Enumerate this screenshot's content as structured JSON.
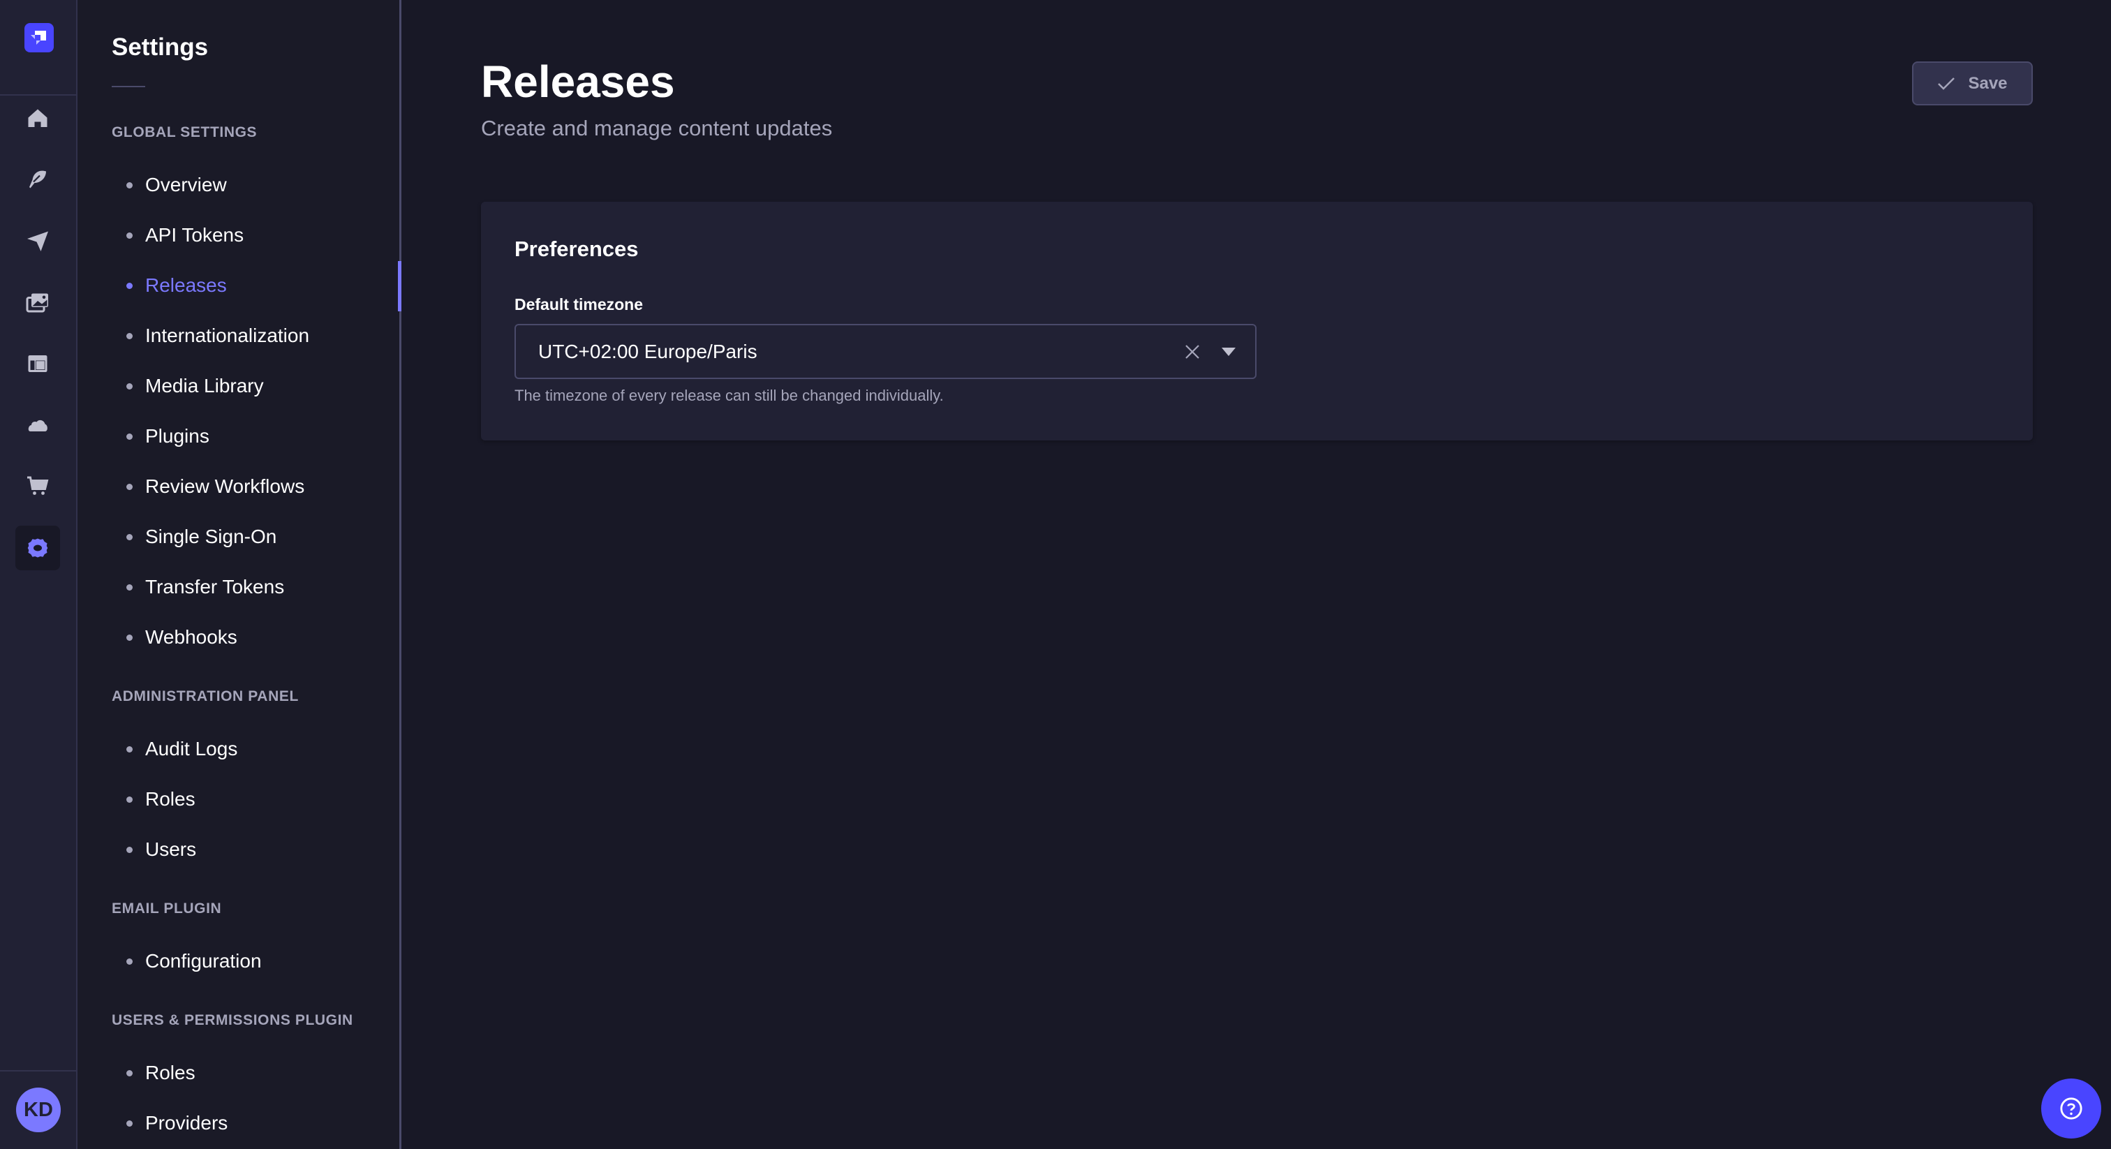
{
  "nav_rail": {
    "items": [
      {
        "icon": "home-icon",
        "label": "Home"
      },
      {
        "icon": "feather-icon",
        "label": "Content Manager"
      },
      {
        "icon": "paper-plane-icon",
        "label": "Releases"
      },
      {
        "icon": "images-icon",
        "label": "Media Library"
      },
      {
        "icon": "layout-icon",
        "label": "Content-Type Builder"
      },
      {
        "icon": "cloud-icon",
        "label": "Deploy"
      },
      {
        "icon": "shopping-cart-icon",
        "label": "Marketplace"
      },
      {
        "icon": "gear-icon",
        "label": "Settings",
        "active": true
      }
    ],
    "avatar_initials": "KD"
  },
  "sidebar": {
    "title": "Settings",
    "sections": [
      {
        "title": "GLOBAL SETTINGS",
        "items": [
          "Overview",
          "API Tokens",
          "Releases",
          "Internationalization",
          "Media Library",
          "Plugins",
          "Review Workflows",
          "Single Sign-On",
          "Transfer Tokens",
          "Webhooks"
        ]
      },
      {
        "title": "ADMINISTRATION PANEL",
        "items": [
          "Audit Logs",
          "Roles",
          "Users"
        ]
      },
      {
        "title": "EMAIL PLUGIN",
        "items": [
          "Configuration"
        ]
      },
      {
        "title": "USERS & PERMISSIONS PLUGIN",
        "items": [
          "Roles",
          "Providers"
        ]
      }
    ],
    "active_item": "Releases"
  },
  "header": {
    "title": "Releases",
    "subtitle": "Create and manage content updates",
    "save_label": "Save"
  },
  "preferences": {
    "title": "Preferences",
    "timezone_label": "Default timezone",
    "timezone_value": "UTC+02:00 Europe/Paris",
    "timezone_hint": "The timezone of every release can still be changed individually."
  },
  "colors": {
    "accent": "#4945ff",
    "accent_light": "#7b79ff",
    "background": "#181826",
    "surface": "#212134"
  }
}
